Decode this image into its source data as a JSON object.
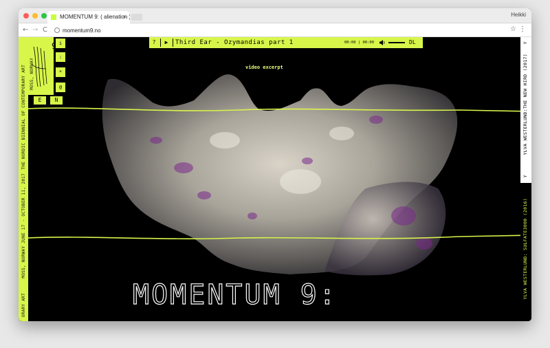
{
  "browser": {
    "tab_title": "MOMENTUM 9: ( alienation )",
    "tab_close": "×",
    "user_name": "Heikki",
    "url": "momentum9.no",
    "back": "←",
    "forward": "→",
    "reload": "C",
    "star": "☆",
    "menu": "⋮"
  },
  "sidebar": {
    "logo_number": "9",
    "strip_text_1": "ORARY ART",
    "strip_text_2": "MOSS, NORWAY   JUNE 17 - OCTOBER 11, 2017",
    "strip_text_3": "THE NORDIC BIENNIAL OF CONTEMPORARY ART",
    "strip_text_4": "MOSS, NORWAY",
    "menu_items": [
      "i",
      ":",
      "*",
      "@"
    ],
    "lang_items": [
      "E",
      "N"
    ]
  },
  "player": {
    "help": "?",
    "play": "▶",
    "track_title": "Third Ear - Ozymandias part 1",
    "time": "00:00 | 00:00",
    "download": "DL"
  },
  "main": {
    "caption": "video excerpt",
    "headline": "MOMENTUM 9:"
  },
  "right_panel": {
    "text_top": "YLVA WESTERLUND:THE NEW HIRD (2017)",
    "text_top_small": "Y",
    "text_bottom": "YLVA WESTERLUND: SULFATE3000 (2016)",
    "text_bottom_small": "Y"
  },
  "colors": {
    "accent": "#d8f54a",
    "background": "#000000"
  }
}
